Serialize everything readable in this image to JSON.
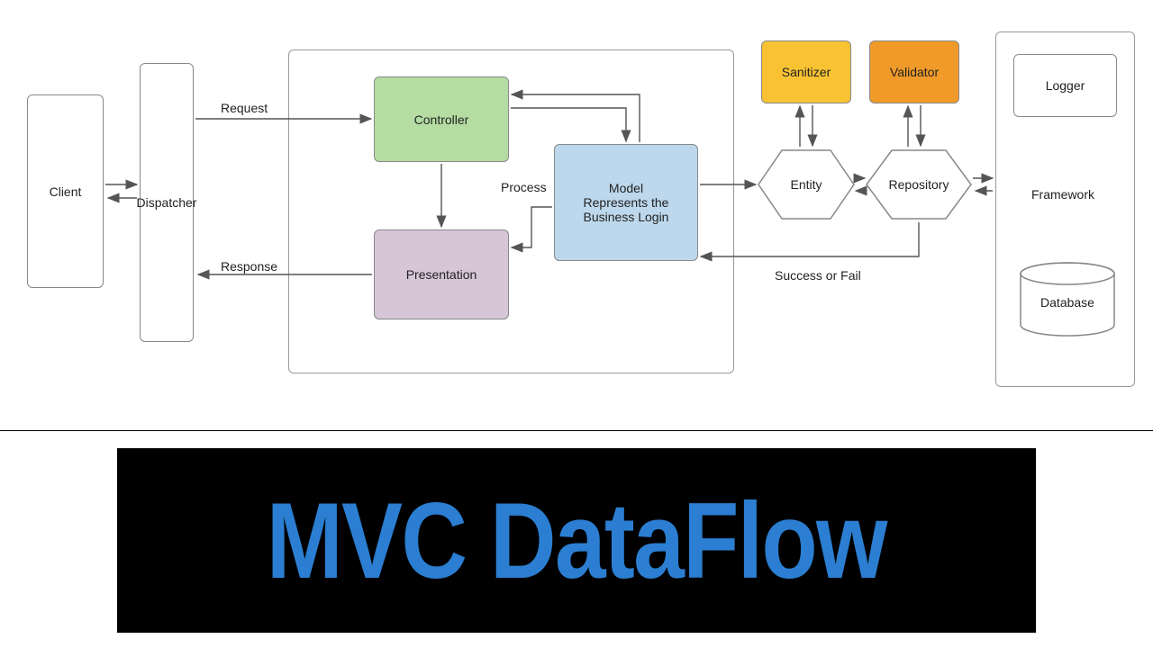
{
  "nodes": {
    "client": "Client",
    "dispatcher": "Dispatcher",
    "controller": "Controller",
    "presentation": "Presentation",
    "model": "Model\nRepresents the\nBusiness Login",
    "entity": "Entity",
    "repository": "Repository",
    "sanitizer": "Sanitizer",
    "validator": "Validator",
    "logger": "Logger",
    "framework": "Framework",
    "database": "Database"
  },
  "labels": {
    "request": "Request",
    "response": "Response",
    "process": "Process",
    "success_fail": "Success or Fail"
  },
  "title": "MVC DataFlow"
}
